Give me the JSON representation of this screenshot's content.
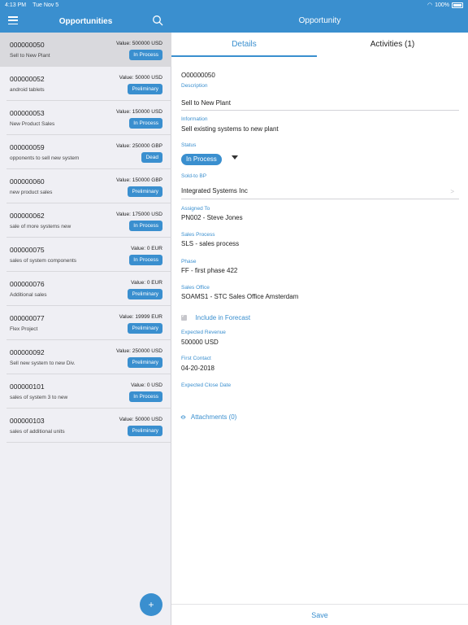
{
  "status_bar": {
    "time": "4:13 PM",
    "date": "Tue Nov 5",
    "battery": "100%"
  },
  "left_nav": {
    "title": "Opportunities"
  },
  "opportunities": [
    {
      "id": "000000050",
      "desc": "Sell to New Plant",
      "value": "Value: 500000 USD",
      "status": "In Process"
    },
    {
      "id": "000000052",
      "desc": "android tablets",
      "value": "Value: 50000 USD",
      "status": "Preliminary"
    },
    {
      "id": "000000053",
      "desc": "New Product Sales",
      "value": "Value: 150000 USD",
      "status": "In Process"
    },
    {
      "id": "000000059",
      "desc": "opponents to sell new system",
      "value": "Value: 250000 GBP",
      "status": "Dead"
    },
    {
      "id": "000000060",
      "desc": "new product sales",
      "value": "Value: 150000 GBP",
      "status": "Preliminary"
    },
    {
      "id": "000000062",
      "desc": "sale of more systems new",
      "value": "Value: 175000 USD",
      "status": "In Process"
    },
    {
      "id": "000000075",
      "desc": "sales of system components",
      "value": "Value: 0 EUR",
      "status": "In Process"
    },
    {
      "id": "000000076",
      "desc": "Additional sales",
      "value": "Value: 0 EUR",
      "status": "Preliminary"
    },
    {
      "id": "000000077",
      "desc": "Flex Project",
      "value": "Value: 19999 EUR",
      "status": "Preliminary"
    },
    {
      "id": "000000092",
      "desc": "Sell new system to new Div.",
      "value": "Value: 250000 USD",
      "status": "Preliminary"
    },
    {
      "id": "000000101",
      "desc": "sales of system 3 to new",
      "value": "Value: 0 USD",
      "status": "In Process"
    },
    {
      "id": "000000103",
      "desc": "sales of additional units",
      "value": "Value: 50000 USD",
      "status": "Preliminary"
    }
  ],
  "fab": {
    "label": "+"
  },
  "right_nav": {
    "title": "Opportunity"
  },
  "tabs": [
    {
      "label": "Details"
    },
    {
      "label": "Activities (1)"
    }
  ],
  "detail": {
    "number": "O00000050",
    "description_label": "Description",
    "description": "Sell to New Plant",
    "information_label": "Information",
    "information": "Sell existing systems to new plant",
    "status_label": "Status",
    "status": "In Process",
    "sold_to_label": "Sold-to BP",
    "sold_to": "Integrated Systems Inc",
    "assigned_label": "Assigned To",
    "assigned": "PN002 - Steve Jones",
    "sales_process_label": "Sales Process",
    "sales_process": "SLS - sales process",
    "phase_label": "Phase",
    "phase": "FF - first phase 422",
    "sales_office_label": "Sales Office",
    "sales_office": "SOAMS1 - STC Sales Office Amsterdam",
    "forecast_label": "Include in Forecast",
    "revenue_label": "Expected Revenue",
    "revenue": "500000 USD",
    "first_contact_label": "First Contact",
    "first_contact": "04-20-2018",
    "close_date_label": "Expected Close Date",
    "attachments": "Attachments (0)"
  },
  "save_label": "Save",
  "colors": {
    "accent": "#3a8fcf"
  }
}
